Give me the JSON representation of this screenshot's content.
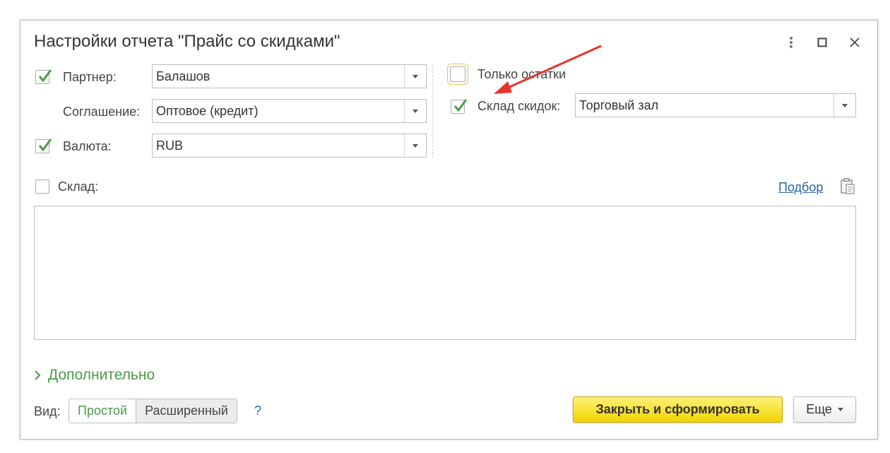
{
  "dialog": {
    "title": "Настройки отчета \"Прайс со скидками\""
  },
  "icons": {
    "menu": "more-vertical-icon",
    "maximize": "maximize-icon",
    "close": "close-icon",
    "check": "check-icon",
    "dropdown": "dropdown-arrow-icon",
    "paste": "clipboard-icon",
    "chevron": "chevron-right-icon"
  },
  "fields": {
    "partner": {
      "label": "Партнер:",
      "value": "Балашов",
      "checked": true
    },
    "agreement": {
      "label": "Соглашение:",
      "value": "Оптовое (кредит)"
    },
    "currency": {
      "label": "Валюта:",
      "value": "RUB",
      "checked": true
    },
    "only_stock": {
      "label": "Только остатки",
      "checked": false
    },
    "discount_warehouse": {
      "label": "Склад скидок:",
      "value": "Торговый зал",
      "checked": true
    },
    "warehouse": {
      "label": "Склад:",
      "checked": false
    }
  },
  "pick_link": "Подбор",
  "additional": {
    "label": "Дополнительно"
  },
  "view": {
    "label": "Вид:",
    "options": [
      "Простой",
      "Расширенный"
    ],
    "selected": "Простой",
    "help": "?"
  },
  "buttons": {
    "close_and_generate": "Закрыть и сформировать",
    "more": "Еще"
  },
  "colors": {
    "accent_green": "#4a9c47",
    "link_blue": "#2366a8",
    "primary_yellow": "#f2d500",
    "annotation_red": "#e8322a"
  }
}
